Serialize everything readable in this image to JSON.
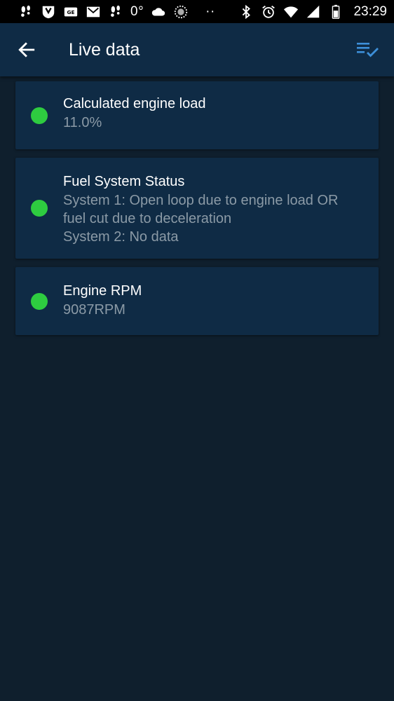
{
  "status_bar": {
    "temperature": "0°",
    "dots": "··",
    "time": "23:29",
    "icons_left": [
      "footprints-icon",
      "shield-icon",
      "ge-icon",
      "gmail-icon",
      "footprints-icon",
      "cloud-icon",
      "circle-icon"
    ],
    "icons_right": [
      "bluetooth-icon",
      "alarm-icon",
      "wifi-icon",
      "signal-icon",
      "battery-icon"
    ]
  },
  "app_bar": {
    "title": "Live data",
    "back_icon": "arrow-left-icon",
    "action_icon": "playlist-check-icon",
    "action_color": "#3d8fd8"
  },
  "items": [
    {
      "title": "Calculated engine load",
      "value": "11.0%",
      "status_color": "#2ecc40"
    },
    {
      "title": "Fuel System Status",
      "value": "System 1: Open loop due to engine load OR\nfuel cut due to deceleration\nSystem 2: No data",
      "status_color": "#2ecc40"
    },
    {
      "title": "Engine RPM",
      "value": "9087RPM",
      "status_color": "#2ecc40"
    }
  ]
}
